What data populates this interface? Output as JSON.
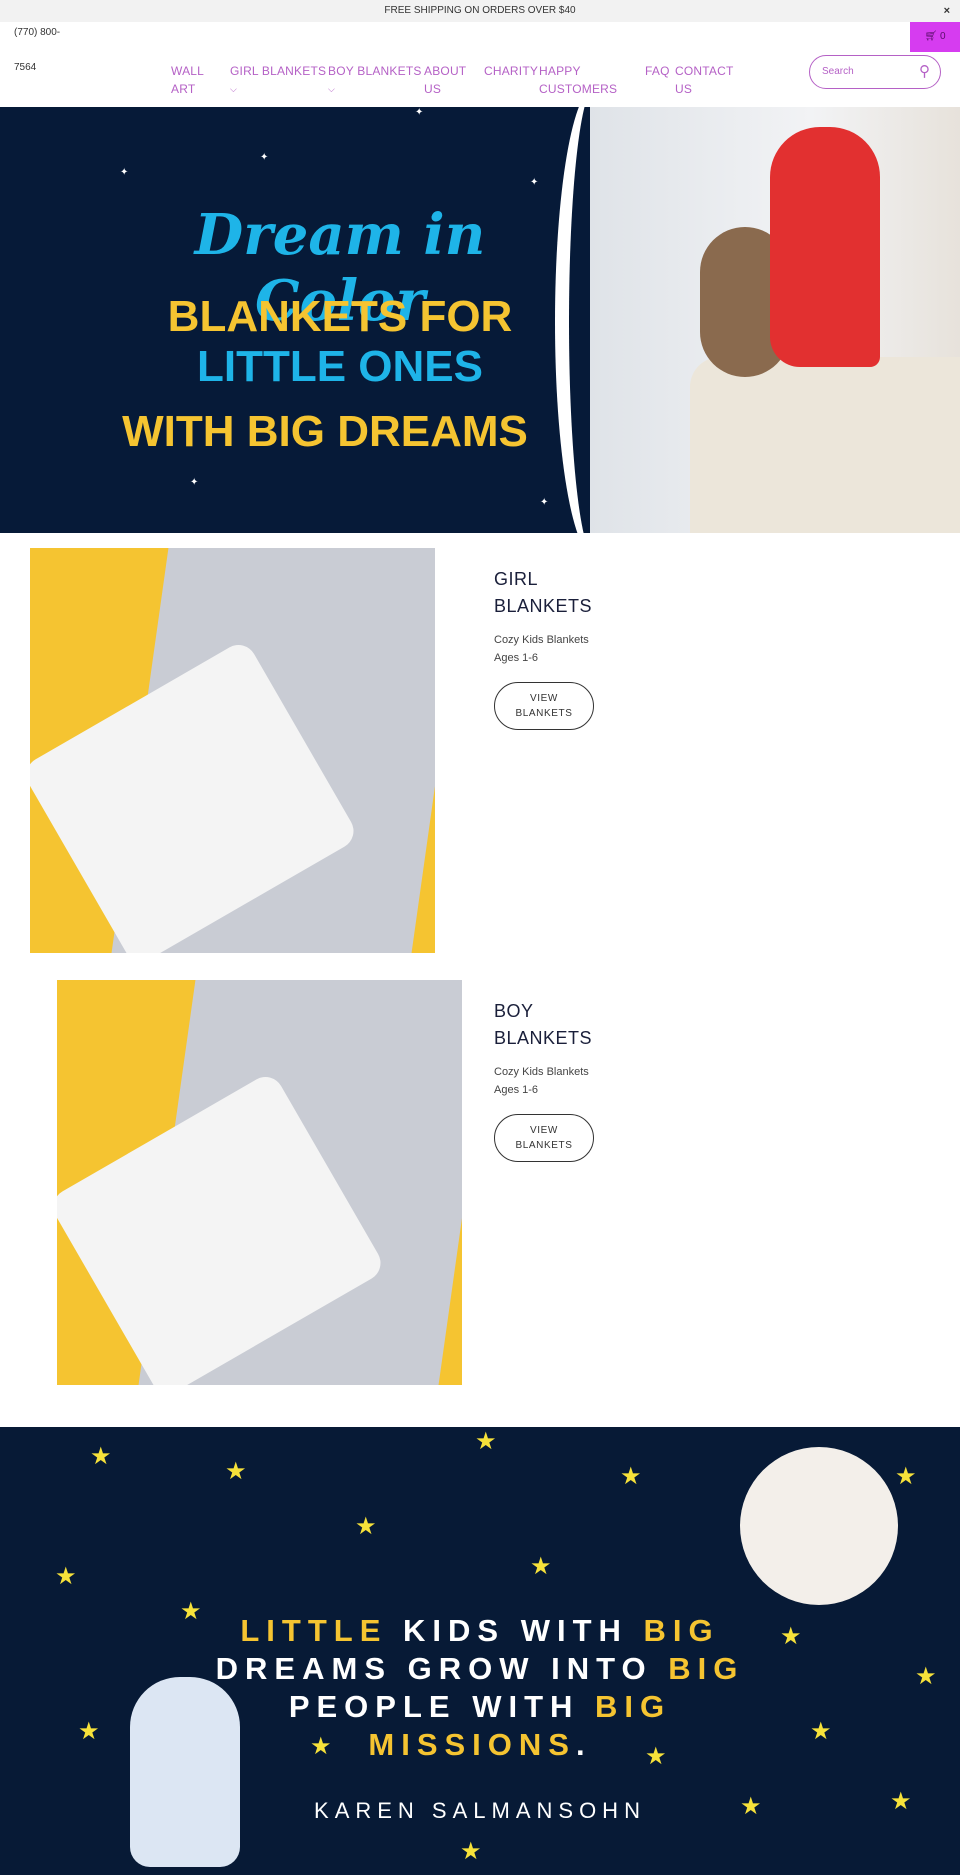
{
  "announcement": {
    "text": "FREE SHIPPING ON ORDERS OVER $40",
    "close": "×"
  },
  "header": {
    "phone_line1": "(770) 800-",
    "phone_line2": "7564",
    "cart_count": "0",
    "search_placeholder": "Search",
    "nav": [
      {
        "label_l1": "WALL",
        "label_l2": "ART"
      },
      {
        "label_l1": "GIRL BLANKETS",
        "chevron": "⌵"
      },
      {
        "label_l1": "BOY BLANKETS",
        "chevron": "⌵"
      },
      {
        "label_l1": "ABOUT",
        "label_l2": "US"
      },
      {
        "label_l1": "CHARITY"
      },
      {
        "label_l1": "HAPPY",
        "label_l2": "CUSTOMERS"
      },
      {
        "label_l1": "FAQ"
      },
      {
        "label_l1": "CONTACT",
        "label_l2": "US"
      }
    ]
  },
  "hero": {
    "line1": "Dream in Color",
    "line2": "BLANKETS FOR",
    "line3": "LITTLE ONES",
    "line4": "WITH BIG DREAMS"
  },
  "products": [
    {
      "title_l1": "GIRL",
      "title_l2": "BLANKETS",
      "sub1": "Cozy Kids Blankets",
      "sub2": "Ages 1-6",
      "btn_l1": "VIEW",
      "btn_l2": "BLANKETS"
    },
    {
      "title_l1": "BOY",
      "title_l2": "BLANKETS",
      "sub1": "Cozy Kids Blankets",
      "sub2": "Ages 1-6",
      "btn_l1": "VIEW",
      "btn_l2": "BLANKETS"
    }
  ],
  "quote": {
    "w1": "LITTLE",
    "w2": "KIDS WITH",
    "w3": "BIG",
    "w4": "DREAMS GROW INTO",
    "w5": "BIG",
    "w6": "PEOPLE WITH",
    "w7": "BIG",
    "w8": "MISSIONS",
    "w9": ".",
    "author": "KAREN SALMANSOHN"
  },
  "colors": {
    "accent": "#b561c6",
    "cart": "#d63cf0",
    "navy": "#061a38",
    "yellow": "#f5c431"
  }
}
